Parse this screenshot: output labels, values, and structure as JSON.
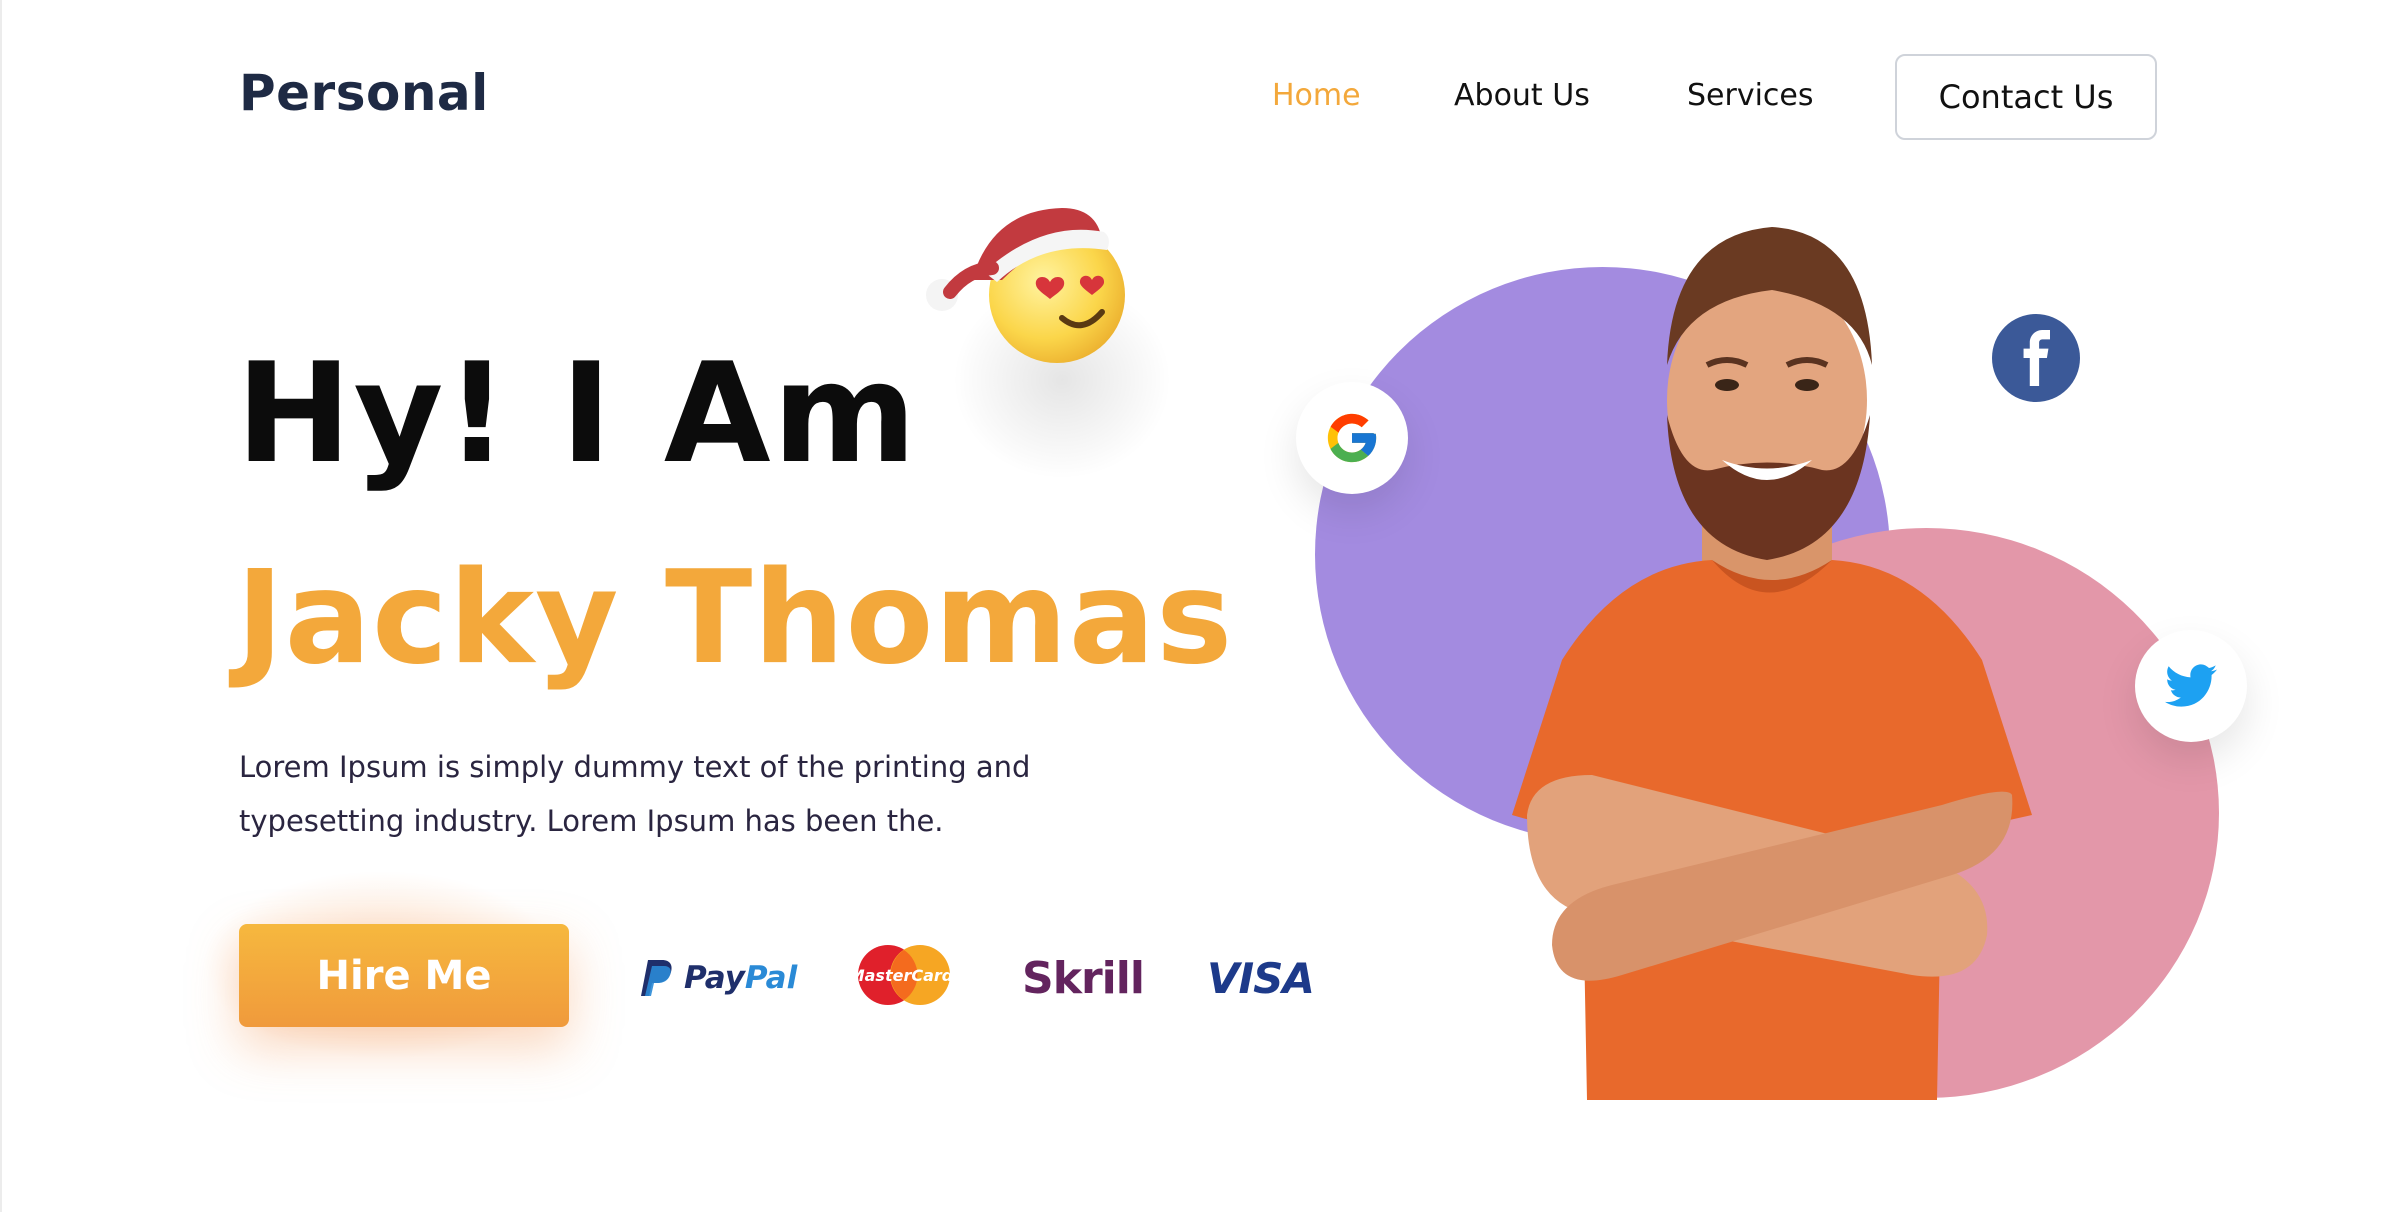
{
  "nav": {
    "logo": "Personal",
    "items": [
      {
        "label": "Home",
        "active": true
      },
      {
        "label": "About Us"
      },
      {
        "label": "Services"
      }
    ],
    "contact_label": "Contact Us"
  },
  "hero": {
    "greeting": "Hy! I Am",
    "name": "Jacky Thomas",
    "description": "Lorem Ipsum is simply dummy text of the printing and typesetting industry. Lorem Ipsum has been the.",
    "cta_label": "Hire Me"
  },
  "payments": {
    "paypal_part1": "Pay",
    "paypal_part2": "Pal",
    "mastercard_text": "MasterCard.",
    "skrill": "Skrill",
    "visa": "VISA"
  },
  "social": [
    "google-icon",
    "facebook-icon",
    "twitter-icon"
  ],
  "colors": {
    "accent": "#f3a83b",
    "navy": "#1e2a44",
    "purple_circle": "#a38be0",
    "pink_circle": "#e397a9",
    "shirt": "#e8692c",
    "facebook": "#3b5998",
    "twitter": "#1da1f2"
  }
}
